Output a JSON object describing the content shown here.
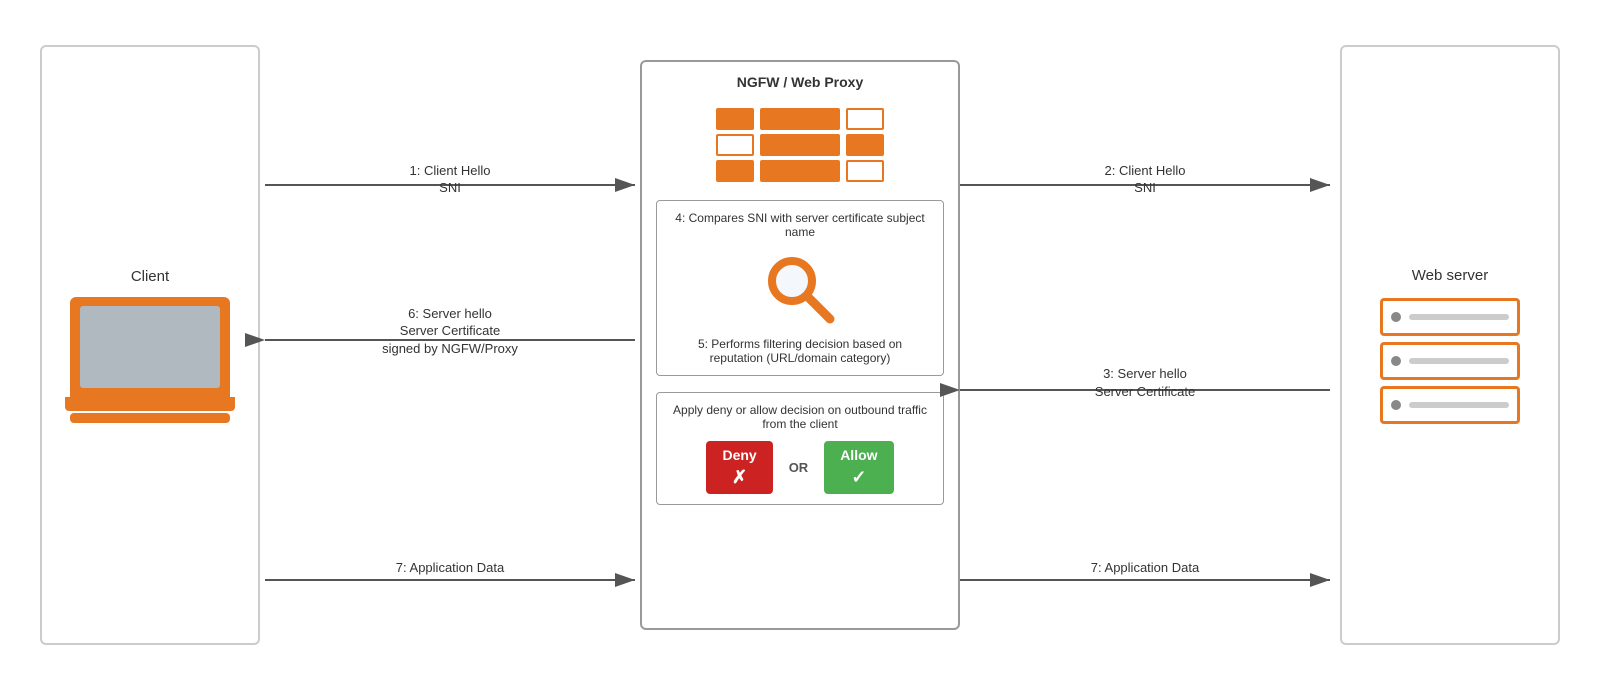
{
  "client": {
    "label": "Client"
  },
  "ngfw": {
    "title": "NGFW / Web Proxy"
  },
  "webserver": {
    "label": "Web server"
  },
  "arrows": {
    "arrow1_label_line1": "1: Client Hello",
    "arrow1_label_line2": "SNI",
    "arrow2_label_line1": "2: Client Hello",
    "arrow2_label_line2": "SNI",
    "arrow3_label_line1": "3: Server hello",
    "arrow3_label_line2": "Server Certificate",
    "arrow6_label_line1": "6: Server hello",
    "arrow6_label_line2": "Server Certificate",
    "arrow6_label_line3": "signed by NGFW/Proxy",
    "arrow7left_label": "7: Application Data",
    "arrow7right_label": "7: Application Data"
  },
  "step4": {
    "label": "4: Compares SNI with server certificate subject name"
  },
  "step5": {
    "label": "5: Performs filtering decision based on reputation (URL/domain category)"
  },
  "decision": {
    "label": "Apply deny or allow decision on outbound traffic from the client",
    "deny_label": "Deny",
    "allow_label": "Allow",
    "or_label": "OR",
    "deny_icon": "✗",
    "allow_icon": "✓"
  }
}
